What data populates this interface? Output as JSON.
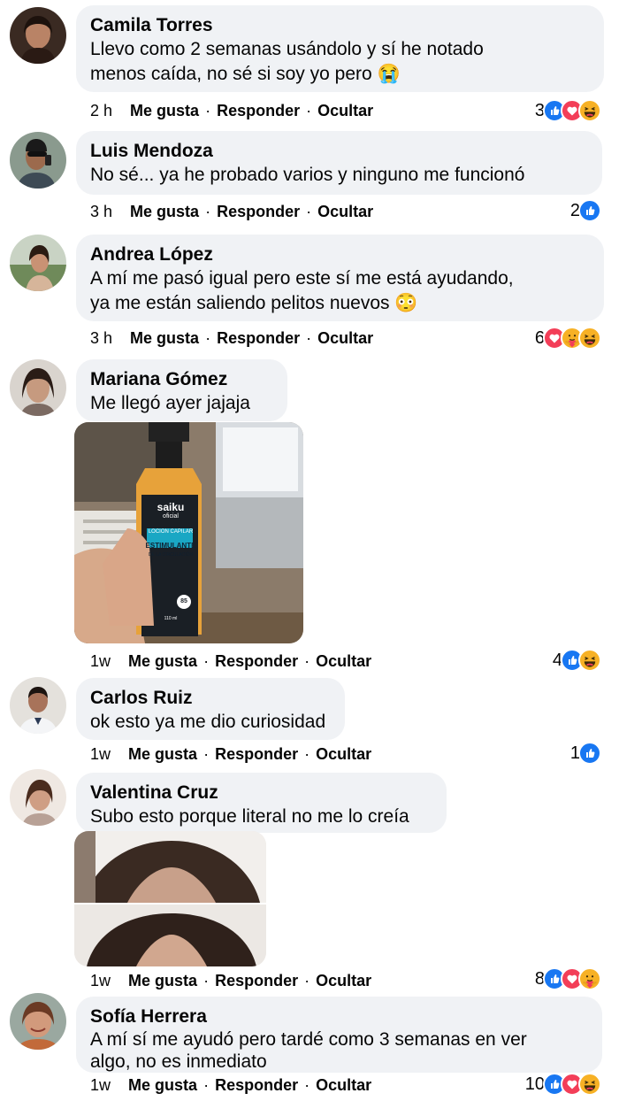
{
  "actions": {
    "like": "Me gusta",
    "reply": "Responder",
    "hide": "Ocultar",
    "sep": "·"
  },
  "comments": [
    {
      "author": "Camila Torres",
      "lines": [
        "Llevo como 2 semanas usándolo y sí he notado",
        "menos caída, no sé si soy yo pero 😭"
      ],
      "time": "2 h",
      "count": "3",
      "reactions": [
        "like-icon",
        "love-icon",
        "haha-icon"
      ]
    },
    {
      "author": "Luis Mendoza",
      "lines": [
        "No sé... ya he probado varios y ninguno me funcionó"
      ],
      "time": "3 h",
      "count": "2",
      "reactions": [
        "like-icon"
      ]
    },
    {
      "author": "Andrea López",
      "lines": [
        "A mí me pasó igual pero este sí me está ayudando,",
        "ya me están saliendo pelitos nuevos 😳"
      ],
      "time": "3 h",
      "count": "6",
      "reactions": [
        "love-icon",
        "care-icon",
        "haha-icon"
      ]
    },
    {
      "author": "Mariana Gómez",
      "lines": [
        "Me llegó ayer jajaja"
      ],
      "time": "1w",
      "count": "4",
      "reactions": [
        "like-icon",
        "haha-icon"
      ],
      "photo_label": {
        "brand": "saiku",
        "brand_sub": "oficial",
        "product": "LOCION CAPILAR",
        "title1": "ESTIMULANTE",
        "title2": "DE LA CIRCULACIÓN",
        "badge": "85",
        "volume": "110 ml"
      }
    },
    {
      "author": "Carlos Ruiz",
      "lines": [
        "ok esto ya me dio curiosidad"
      ],
      "time": "1w",
      "count": "1",
      "reactions": [
        "like-icon"
      ]
    },
    {
      "author": "Valentina Cruz",
      "lines": [
        "Subo esto porque literal no me lo creía"
      ],
      "time": "1w",
      "count": "8",
      "reactions": [
        "like-icon",
        "love-icon",
        "care-icon"
      ]
    },
    {
      "author": "Sofía Herrera",
      "lines": [
        "A mí sí me ayudó pero tardé como 3 semanas en ver",
        "algo, no es inmediato"
      ],
      "time": "1w",
      "count": "10",
      "reactions": [
        "like-icon",
        "love-icon",
        "haha-icon"
      ]
    }
  ],
  "colors": {
    "bubble": "#f0f2f5",
    "like": "#1877f2",
    "love": "#f33e58",
    "haha": "#f7b125"
  }
}
